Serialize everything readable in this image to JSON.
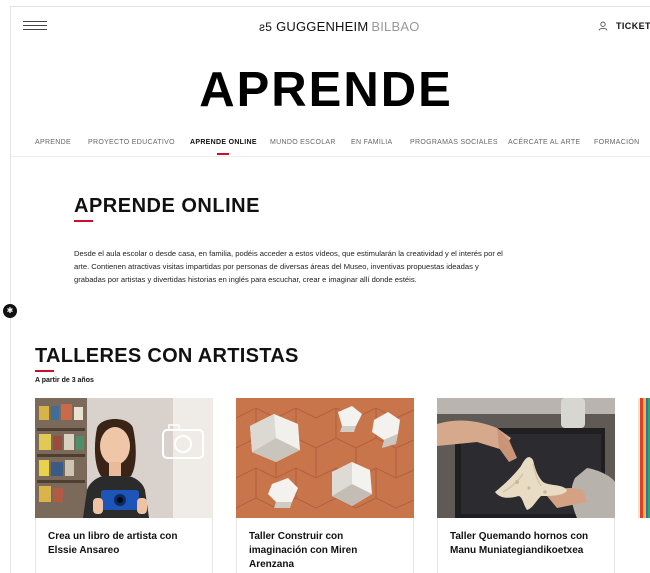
{
  "header": {
    "menu_icon": "hamburger-icon",
    "logo_mark": "ƨ5",
    "logo_brand": "GUGGENHEIM",
    "logo_city": "BILBAO",
    "tickets_label": "TICKETS",
    "tickets_icon": "user-icon"
  },
  "hero": {
    "title": "APRENDE"
  },
  "subnav": {
    "items": [
      {
        "label": "APRENDE"
      },
      {
        "label": "PROYECTO EDUCATIVO"
      },
      {
        "label": "APRENDE ONLINE",
        "active": true
      },
      {
        "label": "MUNDO ESCOLAR"
      },
      {
        "label": "EN FAMILIA"
      },
      {
        "label": "PROGRAMAS SOCIALES"
      },
      {
        "label": "ACÉRCATE AL ARTE"
      },
      {
        "label": "FORMACIÓN"
      }
    ]
  },
  "intro": {
    "title": "APRENDE ONLINE",
    "text": "Desde el aula escolar o desde casa, en familia, podéis acceder a estos vídeos, que estimularán la creatividad y el interés por el arte. Contienen atractivas visitas impartidas por personas de diversas áreas del Museo, inventivas propuestas ideadas y grabadas por artistas y divertidas historias en inglés para escuchar, crear e imaginar allí donde estéis."
  },
  "accessibility": {
    "icon": "accessibility-icon"
  },
  "talleres": {
    "title": "TALLERES CON ARTISTAS",
    "age_note": "A partir de 3 años",
    "cards": [
      {
        "title": "Crea un libro de artista con Elssie Ansareo"
      },
      {
        "title": "Taller Construir con imaginación con Miren Arenzana"
      },
      {
        "title": "Taller Quemando hornos con Manu Muniategiandikoetxea"
      }
    ]
  },
  "colors": {
    "accent": "#c8102e",
    "text": "#111111",
    "muted": "#999999"
  }
}
